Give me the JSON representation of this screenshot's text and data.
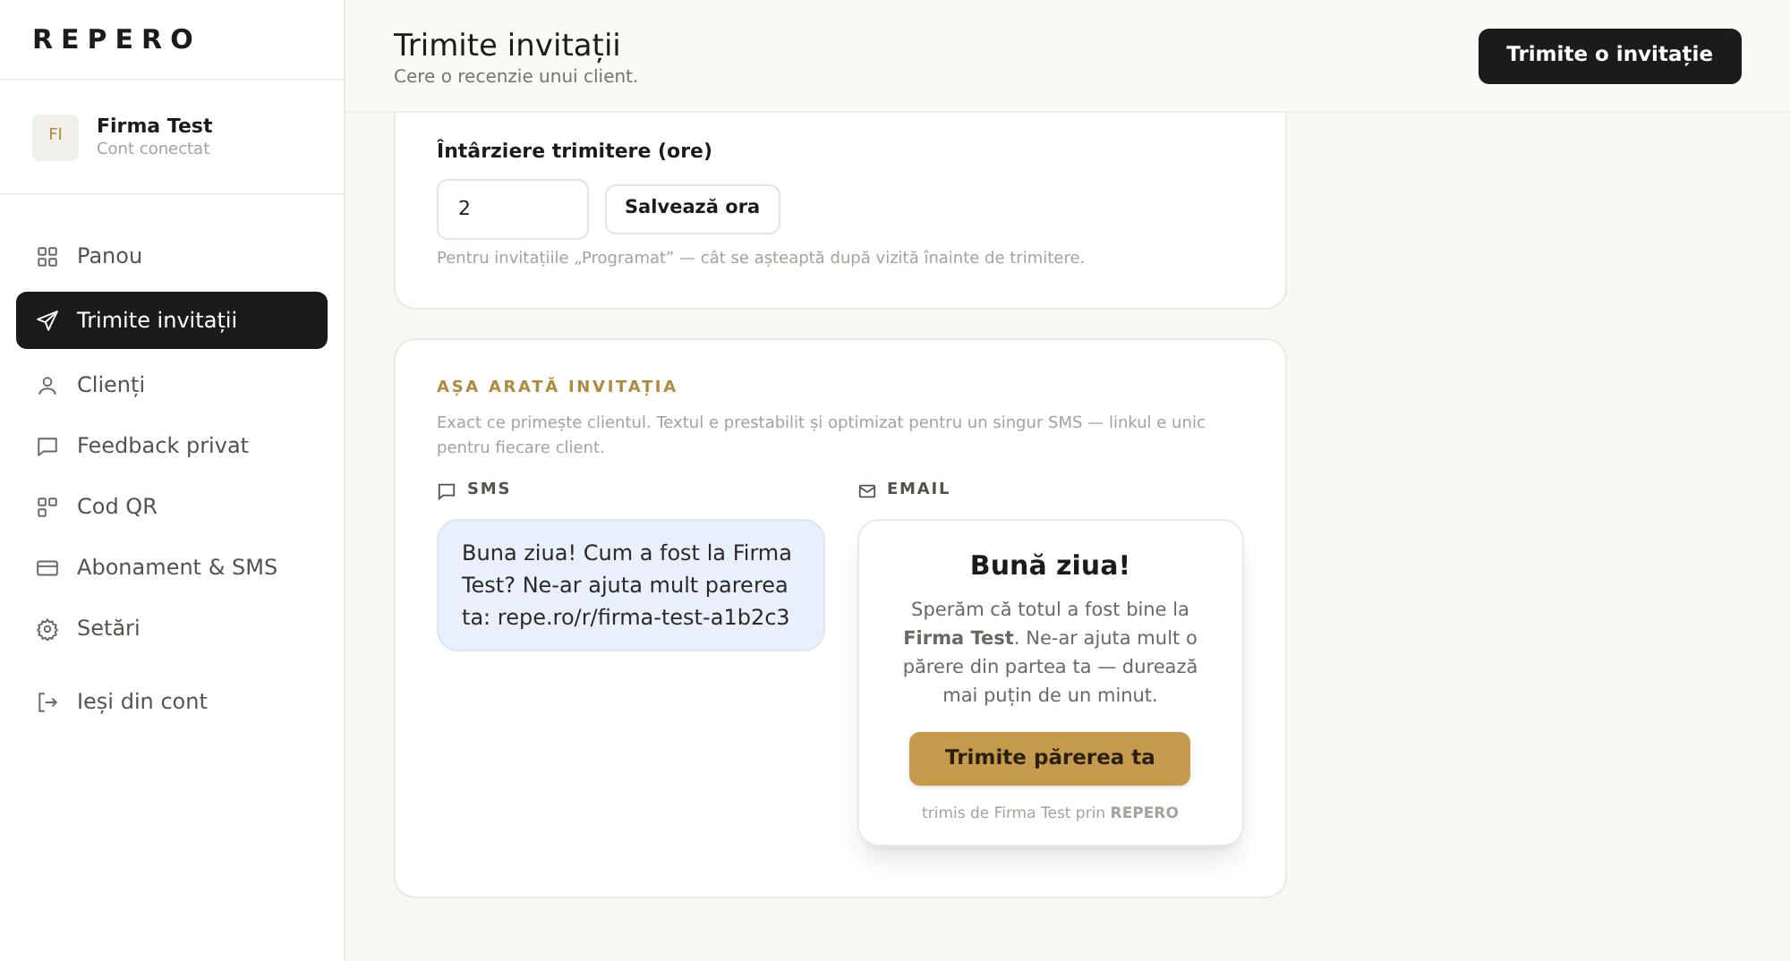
{
  "brand": "REPERO",
  "account": {
    "initials": "FI",
    "name": "Firma Test",
    "status": "Cont conectat"
  },
  "nav": [
    {
      "label": "Panou",
      "kind": "grid",
      "selected": false
    },
    {
      "label": "Trimite invitații",
      "kind": "send",
      "selected": true
    },
    {
      "label": "Clienți",
      "kind": "user",
      "selected": false
    },
    {
      "label": "Feedback privat",
      "kind": "chat",
      "selected": false
    },
    {
      "label": "Cod QR",
      "kind": "qr",
      "selected": false
    },
    {
      "label": "Abonament & SMS",
      "kind": "card",
      "selected": false
    },
    {
      "label": "Setări",
      "kind": "gear",
      "selected": false
    }
  ],
  "logout": "Ieși din cont",
  "header": {
    "title": "Trimite invitații",
    "subtitle": "Cere o recenzie unui client.",
    "action": "Trimite o invitație"
  },
  "delay": {
    "label": "Întârziere trimitere (ore)",
    "value": "2",
    "save": "Salvează ora",
    "hint": "Pentru invitațiile „Programat” — cât se așteaptă după vizită înainte de trimitere."
  },
  "preview": {
    "heading": "AȘA ARATĂ INVITAȚIA",
    "description": "Exact ce primește clientul. Textul e prestabilit și optimizat pentru un singur SMS — linkul e unic pentru fiecare client.",
    "sms": {
      "label": "SMS",
      "message": "Buna ziua! Cum a fost la Firma Test? Ne-ar ajuta mult parerea ta: repe.ro/r/firma-test-a1b2c3"
    },
    "email": {
      "label": "EMAIL",
      "greeting": "Bună ziua!",
      "body": "Sperăm că totul a fost bine la **Firma Test**. Ne-ar ajuta mult o părere din partea ta — durează mai puțin de un minut.",
      "button": "Trimite părerea ta",
      "footer": "trimis de Firma Test prin **REPERO**"
    }
  }
}
